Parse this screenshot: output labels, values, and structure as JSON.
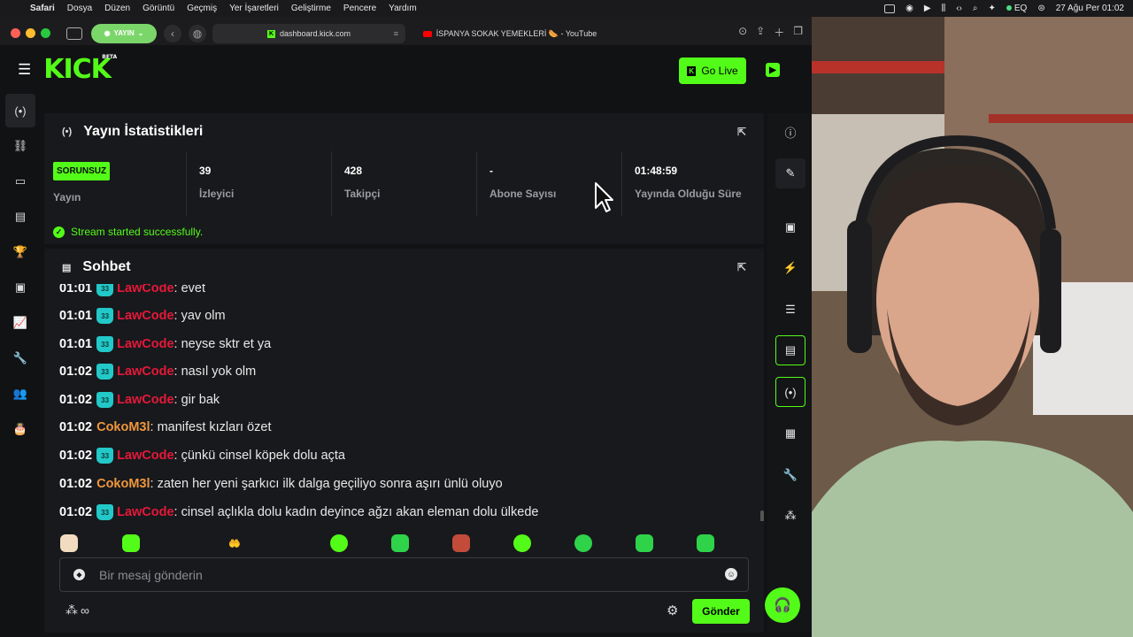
{
  "menubar": {
    "items": [
      "Safari",
      "Dosya",
      "Düzen",
      "Görüntü",
      "Geçmiş",
      "Yer İşaretleri",
      "Geliştirme",
      "Pencere",
      "Yardım"
    ],
    "eq": "EQ",
    "datetime": "27 Ağu Per  01:02"
  },
  "browser": {
    "live_pill": "YAYIN",
    "tab_active": "dashboard.kick.com",
    "tab_second": "İSPANYA SOKAK YEMEKLERİ 🌭 - YouTube"
  },
  "header": {
    "logo": "KICK",
    "logo_tag": "BETA",
    "go_live": "Go Live"
  },
  "stats": {
    "title": "Yayın İstatistikleri",
    "status_badge": "SORUNSUZ",
    "status_label": "Yayın",
    "viewers_value": "39",
    "viewers_label": "İzleyici",
    "followers_value": "428",
    "followers_label": "Takipçi",
    "subs_value": "-",
    "subs_label": "Abone Sayısı",
    "uptime_value": "01:48:59",
    "uptime_label": "Yayında Olduğu Süre",
    "success_message": "Stream started successfully."
  },
  "chat": {
    "title": "Sohbet",
    "messages": [
      {
        "time": "01:01",
        "badge": "33",
        "user": "LawCode",
        "text": "evet"
      },
      {
        "time": "01:01",
        "badge": "33",
        "user": "LawCode",
        "text": "yav olm"
      },
      {
        "time": "01:01",
        "badge": "33",
        "user": "LawCode",
        "text": "neyse sktr et ya"
      },
      {
        "time": "01:02",
        "badge": "33",
        "user": "LawCode",
        "text": "nasıl yok olm"
      },
      {
        "time": "01:02",
        "badge": "33",
        "user": "LawCode",
        "text": "gir bak"
      },
      {
        "time": "01:02",
        "badge": "",
        "user": "CokoM3l",
        "text": "manifest kızları özet"
      },
      {
        "time": "01:02",
        "badge": "33",
        "user": "LawCode",
        "text": "çünkü cinsel köpek dolu açta"
      },
      {
        "time": "01:02",
        "badge": "",
        "user": "CokoM3l",
        "text": "zaten her yeni şarkıcı ilk dalga geçiliyo sonra aşırı ünlü oluyo"
      },
      {
        "time": "01:02",
        "badge": "33",
        "user": "LawCode",
        "text": "cinsel açlıkla dolu kadın deyince ağzı akan eleman dolu ülkede"
      }
    ],
    "input_placeholder": "Bir mesaj gönderin",
    "footer_symbol": "∞",
    "send_label": "Gönder"
  },
  "colors": {
    "accent": "#53fc18",
    "user_lawcode": "#e5193a",
    "user_coko": "#f0973e",
    "sub_badge": "#23c8c8"
  }
}
